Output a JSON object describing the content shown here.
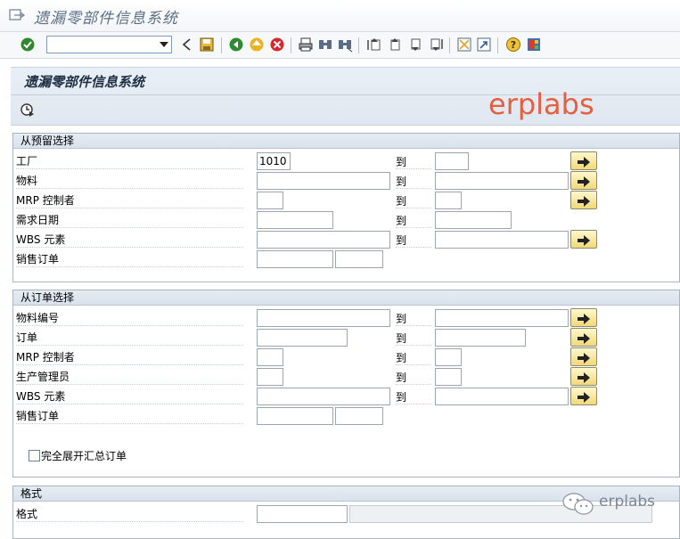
{
  "window": {
    "title": "遗漏零部件信息系统"
  },
  "toolbar": {
    "command_value": "",
    "icons": [
      "check-icon",
      "command-field",
      "back-arrow-icon",
      "save-icon",
      "back-icon",
      "exit-icon",
      "cancel-icon",
      "print-icon",
      "find-icon",
      "find-next-icon",
      "first-page-icon",
      "prev-page-icon",
      "next-page-icon",
      "last-page-icon",
      "new-session-icon",
      "shortcut-icon",
      "help-icon",
      "layout-icon"
    ]
  },
  "header": {
    "title": "遗漏零部件信息系统",
    "watermark": "erplabs"
  },
  "section1": {
    "title": "从预留选择",
    "to_label": "到",
    "rows": [
      {
        "label": "工厂",
        "from": "1010",
        "to": ""
      },
      {
        "label": "物料",
        "from": "",
        "to": ""
      },
      {
        "label": "MRP 控制者",
        "from": "",
        "to": ""
      },
      {
        "label": "需求日期",
        "from": "",
        "to": ""
      },
      {
        "label": "WBS 元素",
        "from": "",
        "to": ""
      },
      {
        "label": "销售订单",
        "from": "",
        "item": ""
      }
    ]
  },
  "section2": {
    "title": "从订单选择",
    "to_label": "到",
    "rows": [
      {
        "label": "物料编号",
        "from": "",
        "to": ""
      },
      {
        "label": "订单",
        "from": "",
        "to": ""
      },
      {
        "label": "MRP 控制者",
        "from": "",
        "to": ""
      },
      {
        "label": "生产管理员",
        "from": "",
        "to": ""
      },
      {
        "label": "WBS 元素",
        "from": "",
        "to": ""
      },
      {
        "label": "销售订单",
        "from": "",
        "item": ""
      }
    ],
    "checkbox_label": "完全展开汇总订单",
    "checkbox_checked": false
  },
  "section3": {
    "title": "格式",
    "rows": [
      {
        "label": "格式",
        "value": "",
        "description": ""
      }
    ]
  },
  "brand": {
    "wechat_text": "erplabs"
  },
  "colors": {
    "title_text": "#5c6f85",
    "header_bg": "#e3eaf2",
    "watermark": "#e4603f",
    "multi_button": "#f1d978"
  }
}
